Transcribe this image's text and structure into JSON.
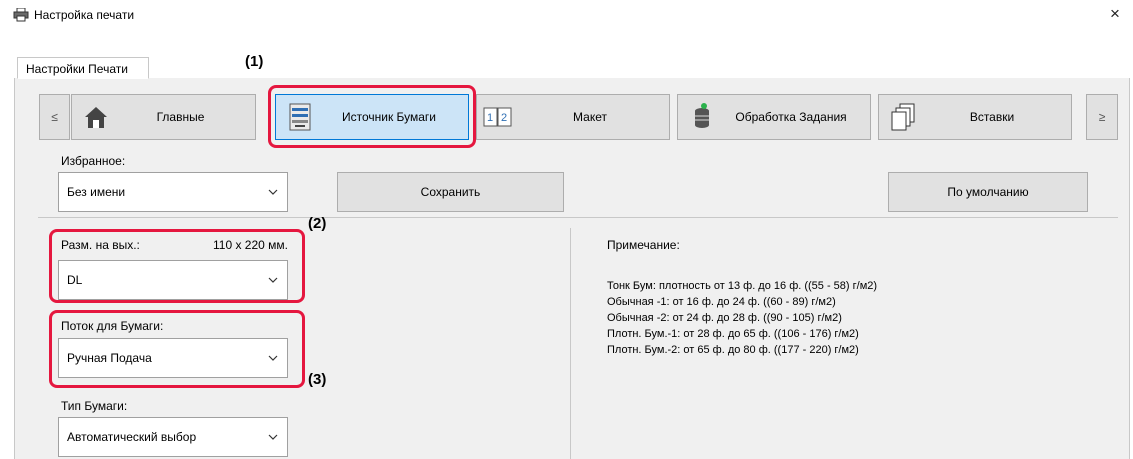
{
  "window": {
    "title": "Настройка печати",
    "close": "×"
  },
  "tab": {
    "label": "Настройки Печати"
  },
  "nav": {
    "prev": "≤",
    "next": "≥",
    "items": [
      {
        "label": "Главные",
        "icon": "home-icon"
      },
      {
        "label": "Источник Бумаги",
        "icon": "paper-tray-icon",
        "active": true
      },
      {
        "label": "Макет",
        "icon": "layout-icon"
      },
      {
        "label": "Обработка Задания",
        "icon": "job-stack-icon"
      },
      {
        "label": "Вставки",
        "icon": "pages-icon"
      }
    ]
  },
  "favorites": {
    "label": "Избранное:",
    "value": "Без имени",
    "save": "Сохранить",
    "default": "По умолчанию"
  },
  "output_size": {
    "label": "Разм. на вых.:",
    "size": "110 x 220 мм.",
    "value": "DL"
  },
  "paper_tray": {
    "label": "Поток для Бумаги:",
    "value": "Ручная Подача"
  },
  "paper_type": {
    "label": "Тип Бумаги:",
    "value": "Автоматический выбор"
  },
  "note": {
    "title": "Примечание:",
    "lines": [
      "Тонк Бум: плотность от 13 ф. до 16 ф. ((55 - 58) г/м2)",
      "Обычная -1: от 16 ф. до 24 ф. ((60 - 89) г/м2)",
      "Обычная -2: от 24 ф. до 28 ф. ((90 - 105) г/м2)",
      "Плотн. Бум.-1: от 28 ф. до 65 ф. ((106 - 176) г/м2)",
      "Плотн. Бум.-2: от 65 ф. до 80 ф. ((177 - 220) г/м2)"
    ]
  },
  "callouts": [
    "(1)",
    "(2)",
    "(3)"
  ],
  "colors": {
    "highlight": "#e5173f",
    "active_tab": "#cce4f7",
    "accent": "#0078d7"
  }
}
